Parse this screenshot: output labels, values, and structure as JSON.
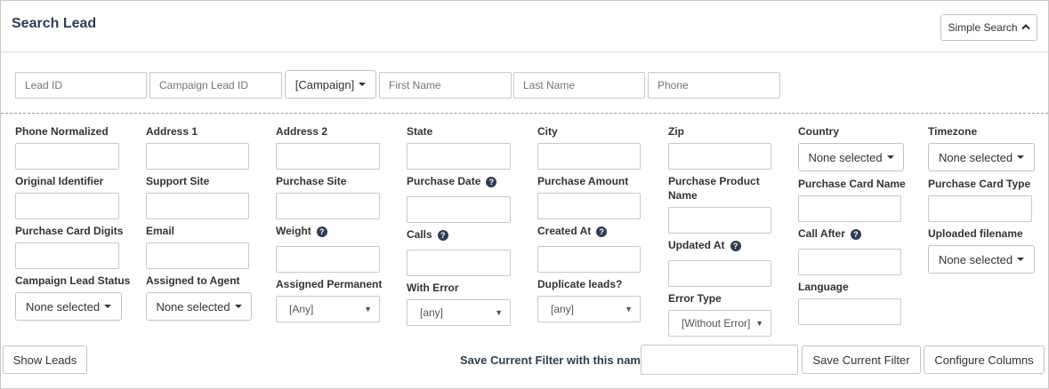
{
  "header": {
    "title": "Search Lead",
    "simple_search_label": "Simple Search"
  },
  "quick": {
    "lead_id_placeholder": "Lead ID",
    "campaign_lead_id_placeholder": "Campaign Lead ID",
    "campaign_label": "[Campaign]",
    "first_name_placeholder": "First Name",
    "last_name_placeholder": "Last Name",
    "phone_placeholder": "Phone"
  },
  "fields": {
    "phone_normalized": "Phone Normalized",
    "address1": "Address 1",
    "address2": "Address 2",
    "state": "State",
    "city": "City",
    "zip": "Zip",
    "country": "Country",
    "timezone": "Timezone",
    "original_identifier": "Original Identifier",
    "support_site": "Support Site",
    "purchase_site": "Purchase Site",
    "purchase_date": "Purchase Date",
    "purchase_amount": "Purchase Amount",
    "purchase_product_name": "Purchase Product Name",
    "purchase_card_name": "Purchase Card Name",
    "purchase_card_type": "Purchase Card Type",
    "purchase_card_digits": "Purchase Card Digits",
    "email": "Email",
    "weight": "Weight",
    "calls": "Calls",
    "created_at": "Created At",
    "updated_at": "Updated At",
    "call_after": "Call After",
    "uploaded_filename": "Uploaded filename",
    "campaign_lead_status": "Campaign Lead Status",
    "assigned_to_agent": "Assigned to Agent",
    "assigned_permanent": "Assigned Permanent",
    "with_error": "With Error",
    "duplicate_leads": "Duplicate leads?",
    "error_type": "Error Type",
    "language": "Language"
  },
  "values": {
    "none_selected": "None selected",
    "assigned_permanent_value": "[Any]",
    "with_error_value": "[any]",
    "duplicate_leads_value": "[any]",
    "error_type_value": "[Without Error]"
  },
  "help_glyph": "?",
  "footer": {
    "show_leads_label": "Show Leads",
    "save_filter_label": "Save Current Filter with this name:",
    "save_current_filter_label": "Save Current Filter",
    "configure_columns_label": "Configure Columns"
  },
  "colors": {
    "title": "#2f3e55",
    "help_icon": "#2f3e55",
    "border": "#c8c8c8"
  },
  "icons": [
    "chevron-up-icon",
    "caret-down-icon",
    "help-icon",
    "select-arrow-icon"
  ]
}
